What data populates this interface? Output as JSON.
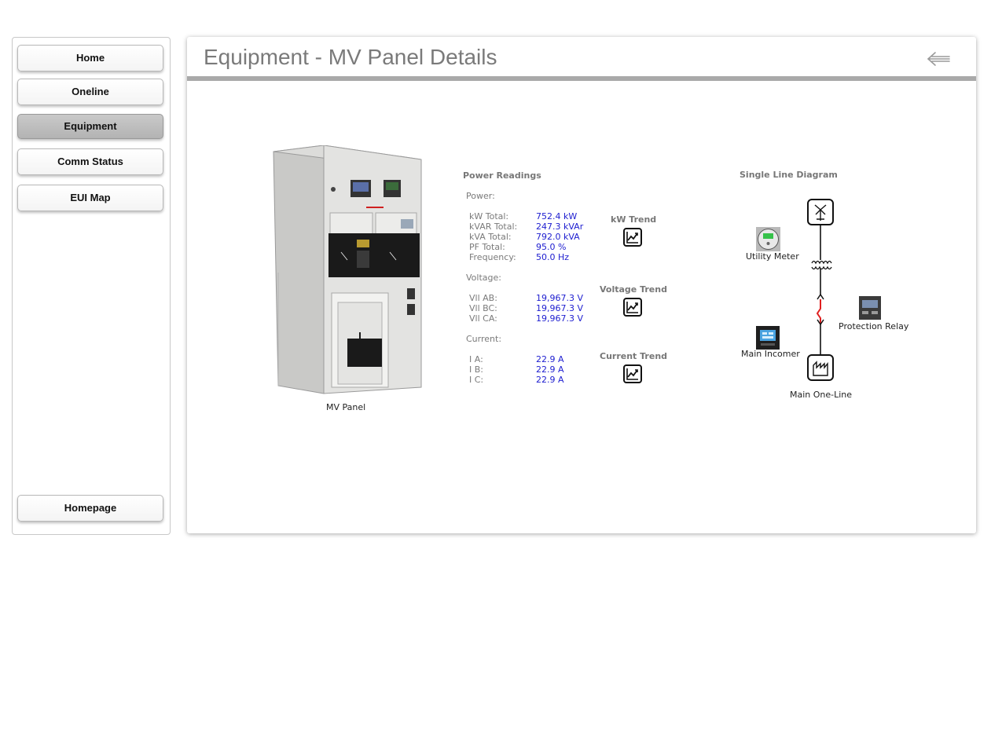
{
  "nav": {
    "home": "Home",
    "oneline": "Oneline",
    "equipment": "Equipment",
    "comm_status": "Comm Status",
    "eui_map": "EUI Map",
    "homepage": "Homepage"
  },
  "header": {
    "title": "Equipment - MV Panel Details"
  },
  "equipment_image": {
    "caption": "MV Panel"
  },
  "readings": {
    "title": "Power Readings",
    "power": {
      "heading": "Power:",
      "rows": [
        {
          "label": "kW Total:",
          "value": "752.4 kW"
        },
        {
          "label": "kVAR Total:",
          "value": "247.3 kVAr"
        },
        {
          "label": "kVA Total:",
          "value": "792.0 kVA"
        },
        {
          "label": "PF Total:",
          "value": "95.0 %"
        },
        {
          "label": "Frequency:",
          "value": "50.0 Hz"
        }
      ],
      "trend_label": "kW Trend"
    },
    "voltage": {
      "heading": "Voltage:",
      "rows": [
        {
          "label": "Vll AB:",
          "value": "19,967.3 V"
        },
        {
          "label": "Vll BC:",
          "value": "19,967.3 V"
        },
        {
          "label": "Vll CA:",
          "value": "19,967.3 V"
        }
      ],
      "trend_label": "Voltage Trend"
    },
    "current": {
      "heading": "Current:",
      "rows": [
        {
          "label": "I A:",
          "value": "22.9 A"
        },
        {
          "label": "I B:",
          "value": "22.9 A"
        },
        {
          "label": "I C:",
          "value": "22.9 A"
        }
      ],
      "trend_label": "Current Trend"
    }
  },
  "sld": {
    "title": "Single Line Diagram",
    "utility_meter": "Utility Meter",
    "protection_relay": "Protection Relay",
    "main_incomer": "Main Incomer",
    "main_oneline": "Main One-Line"
  },
  "colors": {
    "value_text": "#2020d0",
    "breaker_red": "#e02020",
    "active_nav": "#bdbdbd"
  }
}
